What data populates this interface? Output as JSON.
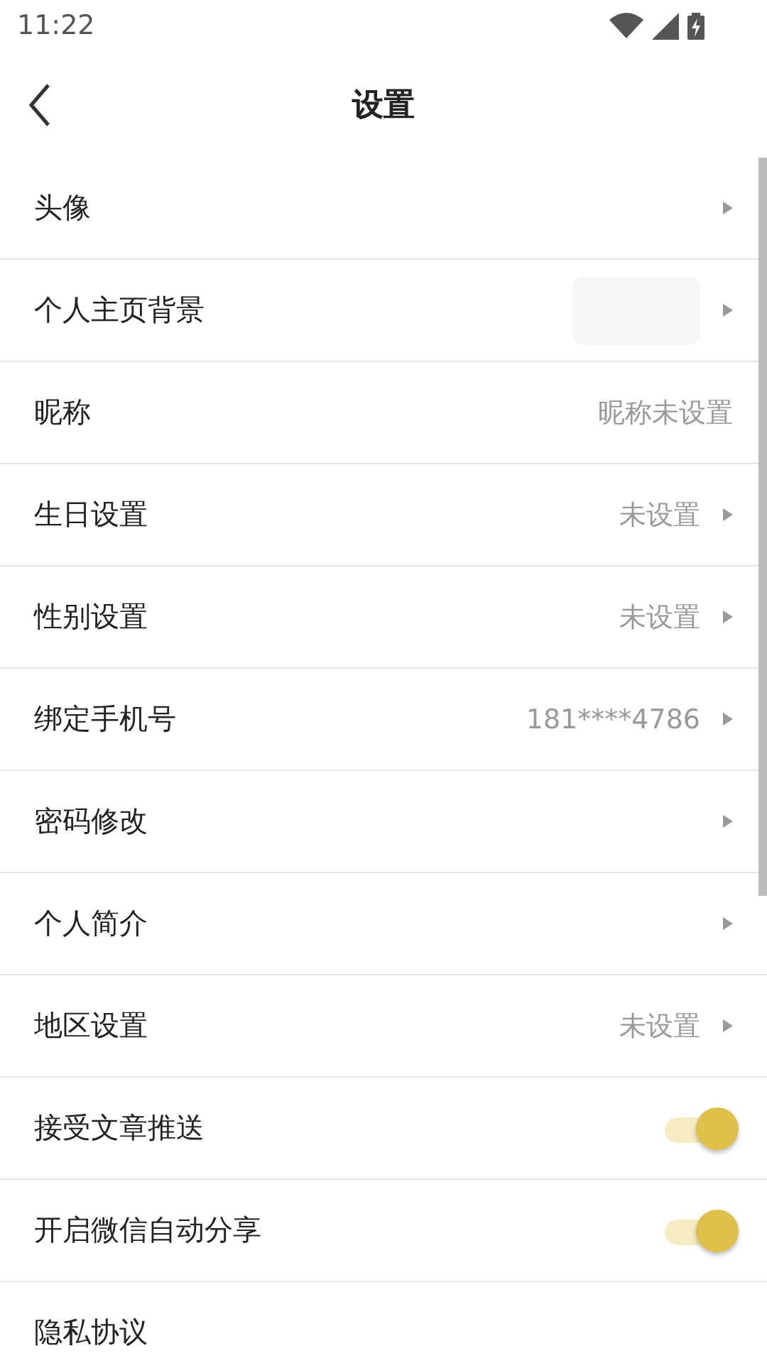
{
  "status_bar": {
    "time": "11:22"
  },
  "header": {
    "title": "设置"
  },
  "rows": [
    {
      "kind": "link",
      "label": "头像",
      "arrow": true
    },
    {
      "kind": "image",
      "label": "个人主页背景",
      "arrow": true
    },
    {
      "kind": "link",
      "label": "昵称",
      "value": "昵称未设置",
      "arrow": false
    },
    {
      "kind": "link",
      "label": "生日设置",
      "value": "未设置",
      "arrow": true
    },
    {
      "kind": "link",
      "label": "性别设置",
      "value": "未设置",
      "arrow": true
    },
    {
      "kind": "link",
      "label": "绑定手机号",
      "value": "181****4786",
      "arrow": true
    },
    {
      "kind": "link",
      "label": "密码修改",
      "arrow": true
    },
    {
      "kind": "link",
      "label": "个人简介",
      "arrow": true
    },
    {
      "kind": "link",
      "label": "地区设置",
      "value": "未设置",
      "arrow": true
    },
    {
      "kind": "toggle",
      "label": "接受文章推送",
      "on": true
    },
    {
      "kind": "toggle",
      "label": "开启微信自动分享",
      "on": true
    },
    {
      "kind": "link",
      "label": "隐私协议",
      "arrow": false
    }
  ]
}
